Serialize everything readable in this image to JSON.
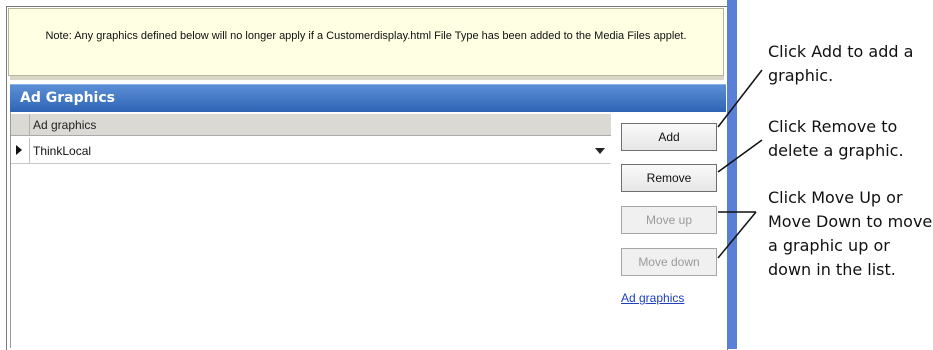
{
  "note": {
    "text": "Note: Any graphics defined below will no longer apply if a Customerdisplay.html File Type has been added to the Media Files applet."
  },
  "section": {
    "title": "Ad Graphics"
  },
  "grid": {
    "column_header": "Ad graphics",
    "rows": [
      {
        "value": "ThinkLocal"
      }
    ]
  },
  "buttons": {
    "add": "Add",
    "remove": "Remove",
    "move_up": "Move up",
    "move_down": "Move down"
  },
  "link": {
    "label": "Ad graphics"
  },
  "callouts": {
    "add": "Click Add to add a graphic.",
    "remove": "Click Remove to delete a graphic.",
    "move": "Click Move Up or Move Down to move a graphic up or down in the list."
  }
}
